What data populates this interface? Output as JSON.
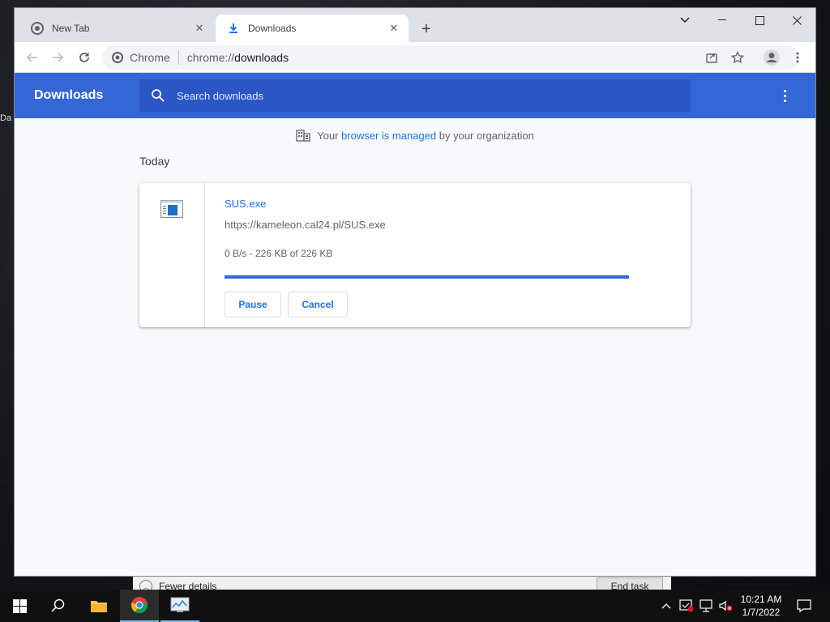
{
  "desktop": {
    "fragments": [
      "Da"
    ]
  },
  "browser": {
    "tabs": [
      {
        "label": "New Tab",
        "icon": "chrome-icon"
      },
      {
        "label": "Downloads",
        "icon": "download-icon"
      }
    ],
    "omnibox": {
      "site": "Chrome",
      "url_prefix": "chrome://",
      "url_host": "downloads"
    }
  },
  "downloads_page": {
    "title": "Downloads",
    "search_placeholder": "Search downloads",
    "managed_notice": {
      "prefix": "Your",
      "link": "browser is managed",
      "suffix": "by your organization"
    },
    "section": "Today",
    "items": [
      {
        "filename": "SUS.exe",
        "source_url": "https://kameleon.cal24.pl/SUS.exe",
        "status": "0 B/s - 226 KB of 226 KB",
        "progress": 1.0,
        "pause_label": "Pause",
        "cancel_label": "Cancel"
      }
    ]
  },
  "task_manager": {
    "fewer_details": "Fewer details",
    "end_task": "End task"
  },
  "taskbar": {
    "time": "10:21 AM",
    "date": "1/7/2022"
  },
  "colors": {
    "accent": "#3367d6",
    "link": "#1a73e8",
    "page_bg": "#f8f9fa"
  }
}
